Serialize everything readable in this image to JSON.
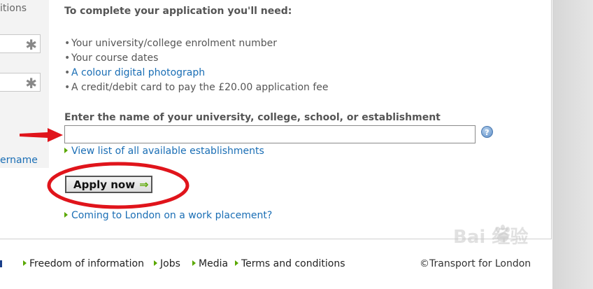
{
  "left_column": {
    "label_fragment": "itions",
    "link_fragment": "ername"
  },
  "requirements": {
    "heading": "To complete your application you'll need:",
    "items": [
      {
        "text": "Your university/college enrolment number",
        "link": false
      },
      {
        "text": "Your course dates",
        "link": false
      },
      {
        "text": "A colour digital photograph",
        "link": true
      },
      {
        "text": "A credit/debit card to pay the £20.00 application fee",
        "link": false
      }
    ]
  },
  "establishment": {
    "label": "Enter the name of your university, college, school, or establishment",
    "value": "",
    "help_icon": "help-question-icon",
    "view_list_link": "View list of all available establishments"
  },
  "apply_button": {
    "label": "Apply now",
    "icon": "green-arrow-icon"
  },
  "work_placement_link": "Coming to London on a work placement?",
  "footer": {
    "links": [
      "Freedom of information",
      "Jobs",
      "Media",
      "Terms and conditions"
    ],
    "copyright": "©Transport for London"
  },
  "watermark": {
    "text": "Bai  经验"
  },
  "colors": {
    "link": "#1a6eb5",
    "accent_green": "#5aa800",
    "annotation_red": "#e0141b"
  }
}
